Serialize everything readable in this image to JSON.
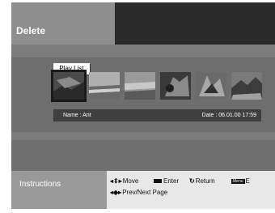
{
  "title": "Delete",
  "playlist_label": "Play List",
  "thumbnails": [
    {
      "id": 1,
      "selected": true
    },
    {
      "id": 2,
      "selected": false
    },
    {
      "id": 3,
      "selected": false
    },
    {
      "id": 4,
      "selected": false
    },
    {
      "id": 5,
      "selected": false
    },
    {
      "id": 6,
      "selected": false
    }
  ],
  "info": {
    "name": "Name : Ant",
    "date": "Date :  06.01.00  17:59"
  },
  "instructions": {
    "title": "Instructions",
    "move": "Move",
    "enter": "Enter",
    "return": "Return",
    "menu_icon_text": "Menu",
    "menu_trailing": "E",
    "prev_next": "Prev/Next Page"
  },
  "icons": {
    "move": "up-down-arrows-icon",
    "enter": "enter-key-icon",
    "return": "return-circle-icon",
    "menu": "menu-button-icon",
    "prev_next": "left-right-arrows-icon"
  }
}
